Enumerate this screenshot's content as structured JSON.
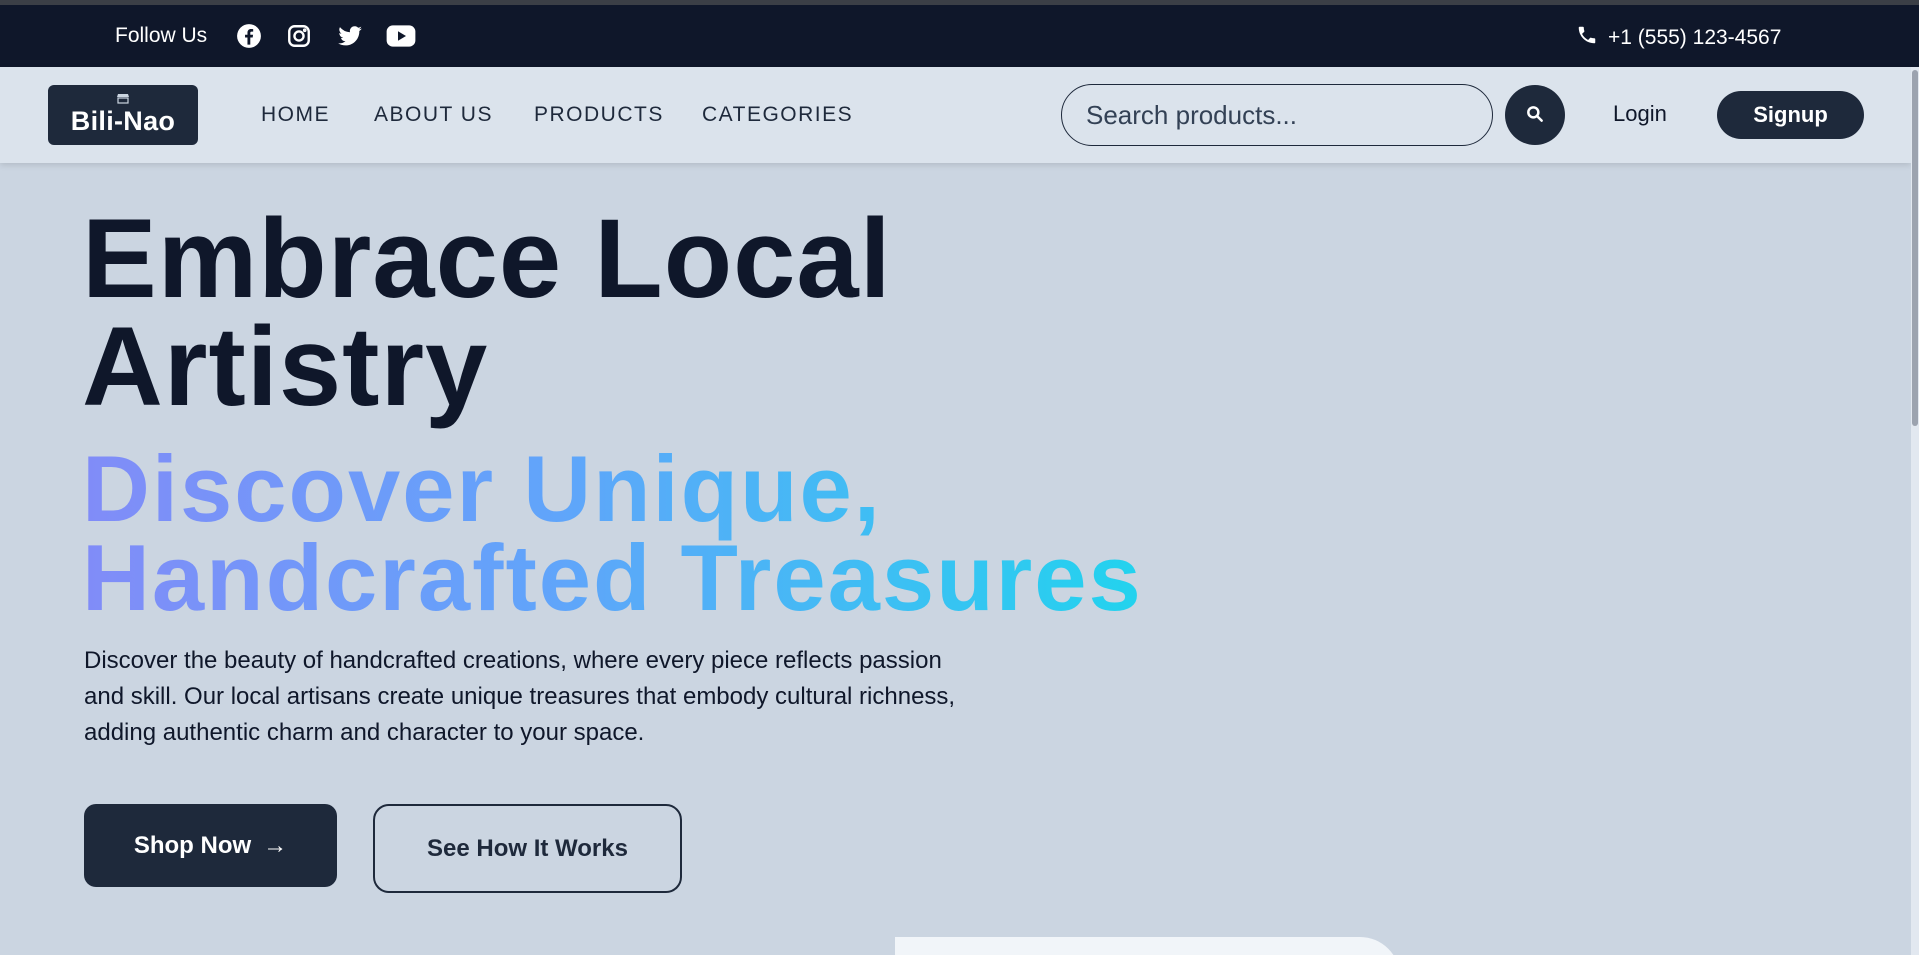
{
  "topbar": {
    "follow_label": "Follow Us",
    "social": [
      {
        "icon": "facebook-icon"
      },
      {
        "icon": "instagram-icon"
      },
      {
        "icon": "twitter-icon"
      },
      {
        "icon": "youtube-icon"
      }
    ],
    "phone": "+1 (555) 123-4567"
  },
  "nav": {
    "logo_text": "Bili-Nao",
    "links": [
      "HOME",
      "ABOUT US",
      "PRODUCTS",
      "CATEGORIES"
    ],
    "search_placeholder": "Search products...",
    "login": "Login",
    "signup": "Signup"
  },
  "hero": {
    "title_line1": "Embrace Local",
    "title_line2": "Artistry",
    "subtitle_line1": "Discover Unique,",
    "subtitle_line2": "Handcrafted Treasures",
    "description": "Discover the beauty of handcrafted creations, where every piece reflects passion and skill. Our local artisans create unique treasures that embody cultural richness, adding authentic charm and character to your space.",
    "primary_button": "Shop Now",
    "primary_arrow": "→",
    "secondary_button": "See How It Works"
  },
  "colors": {
    "topbar_bg": "#0f172a",
    "nav_bg": "#dbe3ec",
    "page_bg": "#cbd5e1",
    "accent_dark": "#1e293b",
    "gradient": [
      "#818cf8",
      "#60a5fa",
      "#22d3ee"
    ]
  }
}
